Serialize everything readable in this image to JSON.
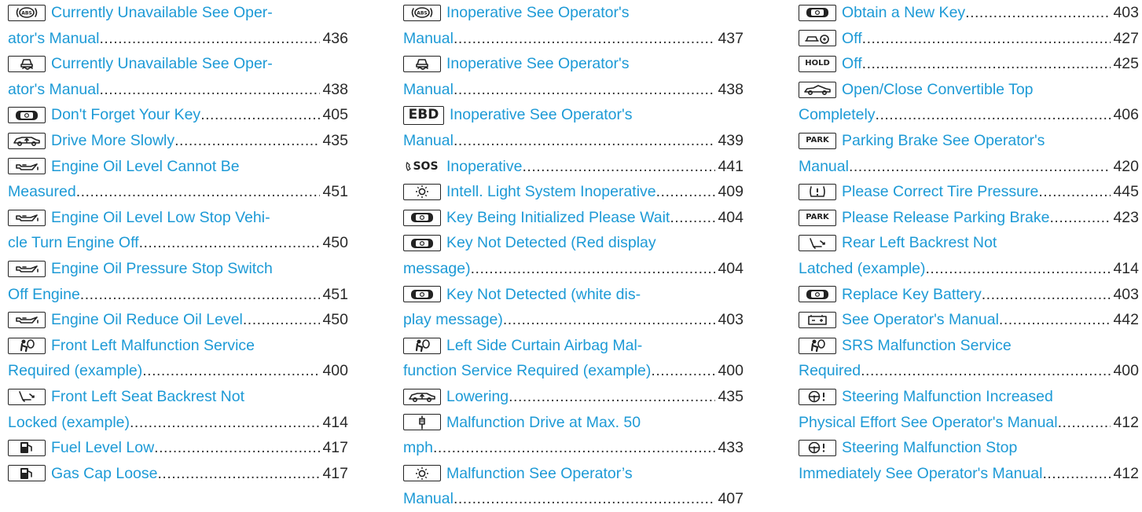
{
  "columns": [
    {
      "entries": [
        {
          "icon": "abs-icon",
          "lines": [
            "Currently Unavailable See Oper-",
            "ator's Manual"
          ],
          "page": "436"
        },
        {
          "icon": "esp-icon",
          "lines": [
            "Currently Unavailable See Oper-",
            "ator's Manual"
          ],
          "page": "438"
        },
        {
          "icon": "key-icon",
          "lines": [
            "Don't Forget Your Key"
          ],
          "page": "405"
        },
        {
          "icon": "car-lift-icon",
          "lines": [
            "Drive More Slowly"
          ],
          "page": "435"
        },
        {
          "icon": "oil-can-icon",
          "lines": [
            "Engine Oil Level Cannot Be",
            "Measured"
          ],
          "page": "451"
        },
        {
          "icon": "oil-can-icon",
          "lines": [
            "Engine Oil Level Low Stop Vehi-",
            "cle Turn Engine Off"
          ],
          "page": "450"
        },
        {
          "icon": "oil-can-icon",
          "lines": [
            "Engine Oil Pressure Stop Switch",
            "Off Engine"
          ],
          "page": "451"
        },
        {
          "icon": "oil-can-icon",
          "lines": [
            "Engine Oil Reduce Oil Level"
          ],
          "page": "450"
        },
        {
          "icon": "airbag-icon",
          "lines": [
            "Front Left Malfunction Service",
            "Required (example)"
          ],
          "page": "400"
        },
        {
          "icon": "seat-backrest-icon",
          "lines": [
            "Front Left Seat Backrest Not",
            "Locked (example)"
          ],
          "page": "414"
        },
        {
          "icon": "fuel-pump-icon",
          "lines": [
            "Fuel Level Low"
          ],
          "page": "417"
        },
        {
          "icon": "fuel-pump-icon",
          "lines": [
            "Gas Cap Loose"
          ],
          "page": "417"
        }
      ]
    },
    {
      "entries": [
        {
          "icon": "abs-icon",
          "lines": [
            "Inoperative See Operator's",
            "Manual"
          ],
          "page": "437"
        },
        {
          "icon": "esp-icon",
          "lines": [
            "Inoperative See Operator's",
            "Manual"
          ],
          "page": "438"
        },
        {
          "icon": "ebd-icon",
          "icon_text": "EBD",
          "lines": [
            "Inoperative See Operator's",
            "Manual"
          ],
          "page": "439"
        },
        {
          "icon": "sos-icon",
          "icon_text": "SOS",
          "lines": [
            "Inoperative"
          ],
          "page": "441"
        },
        {
          "icon": "light-icon",
          "lines": [
            "Intell. Light System Inoperative"
          ],
          "page": "409"
        },
        {
          "icon": "key-icon",
          "lines": [
            "Key Being Initialized Please Wait"
          ],
          "page": "404"
        },
        {
          "icon": "key-icon",
          "lines": [
            "Key Not Detected  (Red display",
            "message)"
          ],
          "page": "404"
        },
        {
          "icon": "key-icon",
          "lines": [
            "Key Not Detected  (white dis-",
            "play message)"
          ],
          "page": "403"
        },
        {
          "icon": "airbag-icon",
          "lines": [
            "Left Side Curtain Airbag Mal-",
            "function Service Required (example)"
          ],
          "page": "400"
        },
        {
          "icon": "car-lift-icon",
          "lines": [
            "Lowering"
          ],
          "page": "435"
        },
        {
          "icon": "shock-absorber-icon",
          "lines": [
            "Malfunction Drive at Max. 50",
            "mph"
          ],
          "page": "433"
        },
        {
          "icon": "light-icon",
          "lines": [
            "Malfunction See Operator’s",
            "Manual"
          ],
          "page": "407"
        }
      ]
    },
    {
      "entries": [
        {
          "icon": "key-icon",
          "lines": [
            "Obtain a New Key"
          ],
          "page": "403"
        },
        {
          "icon": "distance-assist-icon",
          "lines": [
            "Off"
          ],
          "page": "427"
        },
        {
          "icon": "hold-icon",
          "icon_text": "HOLD",
          "lines": [
            "Off"
          ],
          "page": "425"
        },
        {
          "icon": "convertible-icon",
          "lines": [
            "Open/Close Convertible Top",
            "Completely"
          ],
          "page": "406"
        },
        {
          "icon": "park-icon",
          "icon_text": "PARK",
          "lines": [
            "Parking Brake See Operator's",
            "Manual"
          ],
          "page": "420"
        },
        {
          "icon": "tire-pressure-icon",
          "lines": [
            "Please Correct Tire Pressure"
          ],
          "page": "445"
        },
        {
          "icon": "park-icon",
          "icon_text": "PARK",
          "lines": [
            "Please Release Parking Brake"
          ],
          "page": "423"
        },
        {
          "icon": "seat-backrest-icon",
          "lines": [
            "Rear Left Backrest Not",
            "Latched (example)"
          ],
          "page": "414"
        },
        {
          "icon": "key-icon",
          "lines": [
            "Replace Key Battery"
          ],
          "page": "403"
        },
        {
          "icon": "battery-icon",
          "lines": [
            "See Operator's Manual"
          ],
          "page": "442"
        },
        {
          "icon": "airbag-icon",
          "lines": [
            "SRS Malfunction Service",
            "Required"
          ],
          "page": "400"
        },
        {
          "icon": "steering-wheel-icon",
          "lines": [
            "Steering Malfunction Increased",
            "Physical Effort See Operator's Manual"
          ],
          "page": "412"
        },
        {
          "icon": "steering-wheel-icon",
          "lines": [
            "Steering Malfunction Stop",
            "Immediately See Operator's Manual"
          ],
          "page": "412"
        }
      ]
    }
  ]
}
